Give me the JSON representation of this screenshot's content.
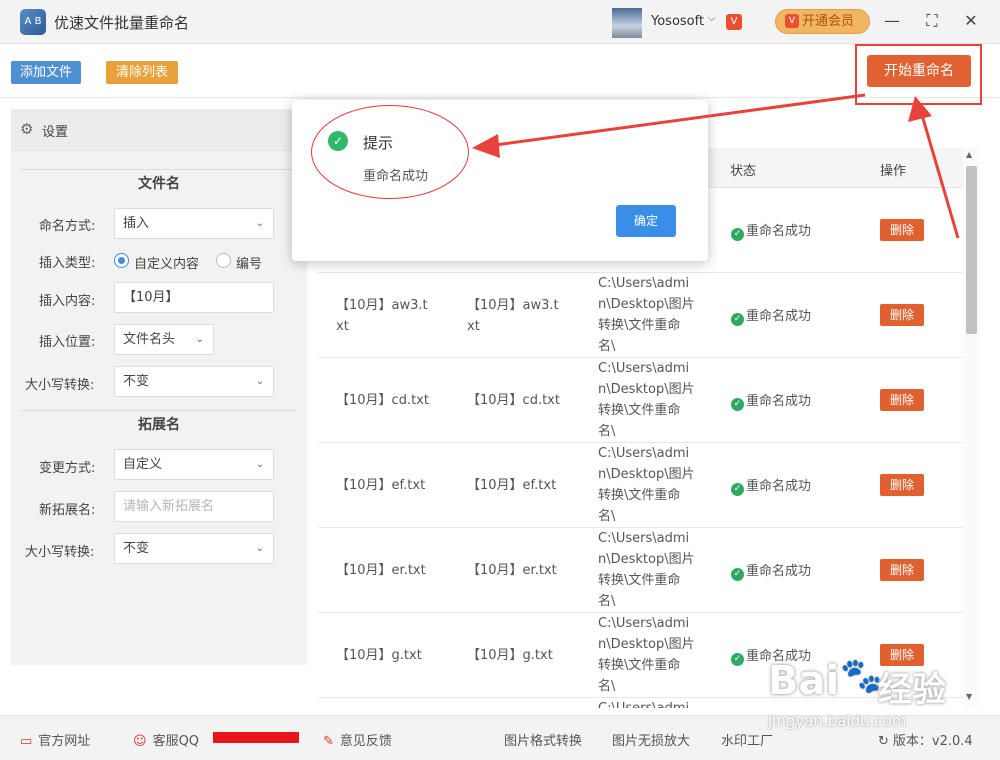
{
  "app": {
    "title": "优速文件批量重命名",
    "logo_text": "A B"
  },
  "user": {
    "name": "Yososoft",
    "chevron": "⌵",
    "badge": "V"
  },
  "vip_button": {
    "label": "开通会员",
    "icon": "V"
  },
  "window_controls": {
    "minimize": "—",
    "maximize": "⛶",
    "close": "✕"
  },
  "toolbar": {
    "add_label": "添加文件",
    "clear_label": "清除列表",
    "start_label": "开始重命名"
  },
  "settings": {
    "title": "设置",
    "gear": "⚙",
    "filename_section": "文件名",
    "naming_mode": {
      "label": "命名方式:",
      "value": "插入"
    },
    "insert_type": {
      "label": "插入类型:",
      "option_custom": "自定义内容",
      "option_number": "编号"
    },
    "insert_content": {
      "label": "插入内容:",
      "value": "【10月】"
    },
    "insert_position": {
      "label": "插入位置:",
      "value": "文件名头"
    },
    "case_convert": {
      "label": "大小写转换:",
      "value": "不变"
    },
    "extension_section": "拓展名",
    "change_mode": {
      "label": "变更方式:",
      "value": "自定义"
    },
    "new_ext": {
      "label": "新拓展名:",
      "placeholder": "请输入新拓展名"
    },
    "ext_case_convert": {
      "label": "大小写转换:",
      "value": "不变"
    }
  },
  "table": {
    "headers": {
      "status": "状态",
      "action": "操作"
    },
    "rows": [
      {
        "orig": "",
        "new": "",
        "path": [
          "",
          "",
          "",
          ""
        ],
        "status": "重命名成功",
        "action": "删除"
      },
      {
        "orig": [
          "【10月】aw3.t",
          "xt"
        ],
        "new": [
          "【10月】aw3.t",
          "xt"
        ],
        "path": [
          "C:\\Users\\admi",
          "n\\Desktop\\图片",
          "转换\\文件重命",
          "名\\"
        ],
        "status": "重命名成功",
        "action": "删除"
      },
      {
        "orig": "【10月】cd.txt",
        "new": "【10月】cd.txt",
        "path": [
          "C:\\Users\\admi",
          "n\\Desktop\\图片",
          "转换\\文件重命",
          "名\\"
        ],
        "status": "重命名成功",
        "action": "删除"
      },
      {
        "orig": "【10月】ef.txt",
        "new": "【10月】ef.txt",
        "path": [
          "C:\\Users\\admi",
          "n\\Desktop\\图片",
          "转换\\文件重命",
          "名\\"
        ],
        "status": "重命名成功",
        "action": "删除"
      },
      {
        "orig": "【10月】er.txt",
        "new": "【10月】er.txt",
        "path": [
          "C:\\Users\\admi",
          "n\\Desktop\\图片",
          "转换\\文件重命",
          "名\\"
        ],
        "status": "重命名成功",
        "action": "删除"
      },
      {
        "orig": "【10月】g.txt",
        "new": "【10月】g.txt",
        "path": [
          "C:\\Users\\admi",
          "n\\Desktop\\图片",
          "转换\\文件重命",
          "名\\"
        ],
        "status": "重命名成功",
        "action": "删除"
      },
      {
        "orig": "",
        "new": "",
        "path": [
          "C:\\Users\\admi",
          "",
          "",
          ""
        ],
        "status": "",
        "action": ""
      }
    ]
  },
  "modal": {
    "title": "提示",
    "message": "重命名成功",
    "ok_label": "确定",
    "check": "✓"
  },
  "footer": {
    "website": "官方网址",
    "qq": "客服QQ",
    "feedback": "意见反馈",
    "img_convert": "图片格式转换",
    "img_enlarge": "图片无损放大",
    "watermark_tool": "水印工厂",
    "version": "版本：v2.0.4"
  },
  "watermark": {
    "brand": "Bai",
    "paw": "🐾",
    "jy": "经验",
    "url": "jingyan.baidu.com"
  },
  "colors": {
    "accent_blue": "#3a8ee6",
    "start_orange": "#e06131",
    "success_green": "#2fb86a",
    "annotation_red": "#e8423a"
  }
}
